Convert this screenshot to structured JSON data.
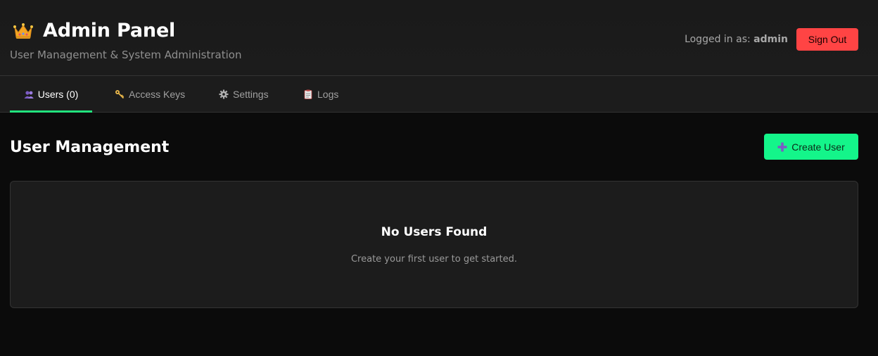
{
  "header": {
    "icon": "crown-icon",
    "title": "Admin Panel",
    "subtitle": "User Management & System Administration",
    "logged_in_label": "Logged in as:",
    "logged_in_user": "admin",
    "sign_out_label": "Sign Out"
  },
  "tabs": [
    {
      "label": "Users (0)",
      "icon": "users-icon",
      "active": true
    },
    {
      "label": "Access Keys",
      "icon": "key-icon",
      "active": false
    },
    {
      "label": "Settings",
      "icon": "gear-icon",
      "active": false
    },
    {
      "label": "Logs",
      "icon": "clipboard-icon",
      "active": false
    }
  ],
  "main": {
    "section_title": "User Management",
    "create_button_label": "Create User",
    "empty_state": {
      "title": "No Users Found",
      "text": "Create your first user to get started."
    }
  },
  "colors": {
    "accent": "#14f58a",
    "danger": "#ff4444",
    "tab_underline": "#22e37d",
    "background": "#0b0b0b",
    "panel": "#1c1c1c"
  }
}
